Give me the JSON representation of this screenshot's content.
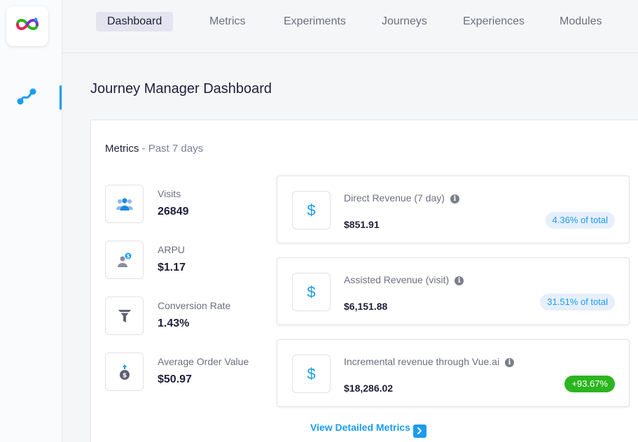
{
  "nav": {
    "tabs": [
      {
        "label": "Dashboard",
        "active": true
      },
      {
        "label": "Metrics"
      },
      {
        "label": "Experiments"
      },
      {
        "label": "Journeys"
      },
      {
        "label": "Experiences"
      },
      {
        "label": "Modules"
      }
    ]
  },
  "sidebar": {
    "logo_icon": "vue-ai-logo-icon",
    "items": [
      {
        "icon": "journey-icon",
        "active": true
      }
    ]
  },
  "page": {
    "title": "Journey Manager Dashboard"
  },
  "metrics": {
    "label": "Metrics",
    "separator": " - ",
    "period": "Past 7 days",
    "items": [
      {
        "icon": "users-icon",
        "label": "Visits",
        "value": "26849"
      },
      {
        "icon": "user-dollar-icon",
        "label": "ARPU",
        "value": "$1.17"
      },
      {
        "icon": "funnel-icon",
        "label": "Conversion Rate",
        "value": "1.43%"
      },
      {
        "icon": "money-bag-icon",
        "label": "Average Order Value",
        "value": "$50.97"
      }
    ]
  },
  "revenue": [
    {
      "icon": "dollar-icon",
      "label": "Direct Revenue (7 day)",
      "value": "$851.91",
      "badge": "4.36% of total",
      "badge_color": "#e6effb"
    },
    {
      "icon": "dollar-icon",
      "label": "Assisted Revenue (visit)",
      "value": "$6,151.88",
      "badge": "31.51% of total",
      "badge_color": "#e6effb"
    },
    {
      "icon": "dollar-icon",
      "label": "Incremental revenue through Vue.ai",
      "value": "$18,286.02",
      "badge": "+93.67%",
      "badge_color": "#2bb51e"
    }
  ],
  "info_glyph": "i",
  "dollar_glyph": "$",
  "view_link": {
    "label": "View Detailed Metrics"
  },
  "colors": {
    "accent": "#1a9cf0",
    "positive": "#2bb51e",
    "text": "#1f1f3a"
  }
}
